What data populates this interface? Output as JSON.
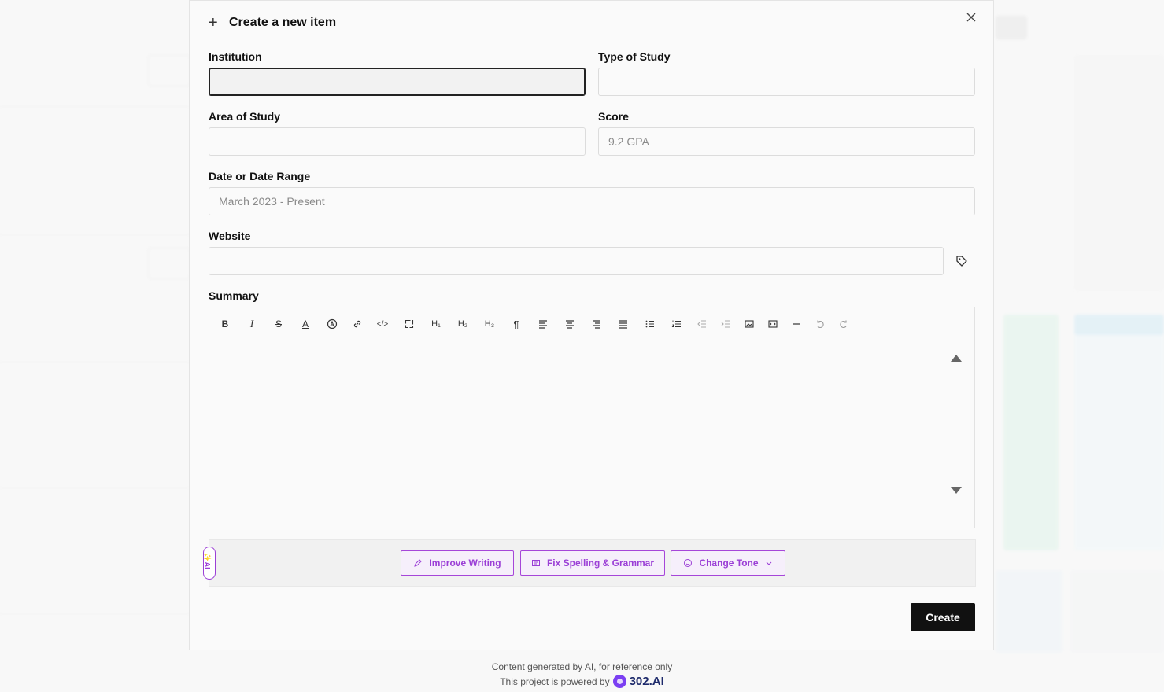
{
  "modal": {
    "title": "Create a new item",
    "plus_icon": "+",
    "close_icon": "close-icon"
  },
  "fields": {
    "institution": {
      "label": "Institution",
      "value": "",
      "placeholder": ""
    },
    "type_of_study": {
      "label": "Type of Study",
      "value": "",
      "placeholder": ""
    },
    "area_of_study": {
      "label": "Area of Study",
      "value": "",
      "placeholder": ""
    },
    "score": {
      "label": "Score",
      "value": "",
      "placeholder": "9.2 GPA"
    },
    "date": {
      "label": "Date or Date Range",
      "value": "",
      "placeholder": "March 2023 - Present"
    },
    "website": {
      "label": "Website",
      "value": "",
      "placeholder": ""
    },
    "summary": {
      "label": "Summary"
    }
  },
  "toolbar": {
    "h1": "H₁",
    "h2": "H₂",
    "h3": "H₃"
  },
  "ai": {
    "badge": "✨AI",
    "improve_label": "Improve Writing",
    "fix_label": "Fix Spelling & Grammar",
    "tone_label": "Change Tone"
  },
  "actions": {
    "create_label": "Create"
  },
  "footer": {
    "line1": "Content generated by AI, for reference only",
    "line2": "This project is powered by",
    "brand": "302.AI"
  },
  "colors": {
    "accent_ai": "#9b3fd6",
    "primary": "#111111",
    "brand": "#7b3ff2"
  }
}
